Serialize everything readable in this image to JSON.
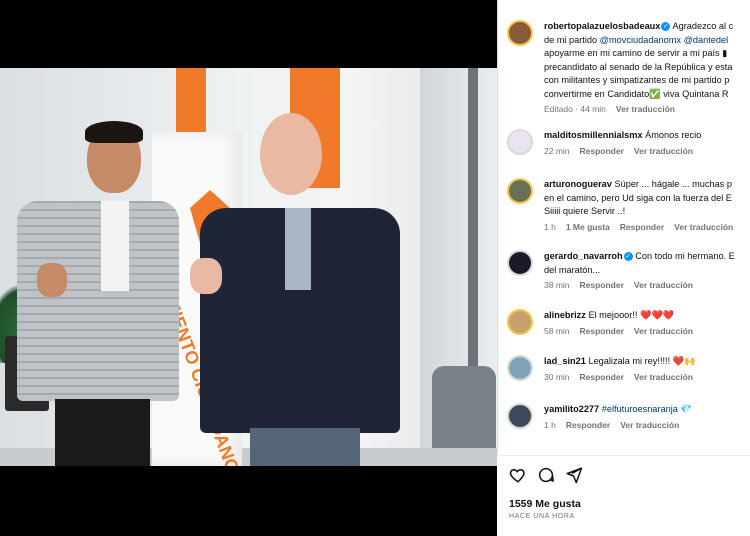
{
  "post_image": {
    "flag_text": "MOVIMIENTO CIUDADANO"
  },
  "comments": [
    {
      "username": "robertopalazuelosbadeaux",
      "verified": true,
      "lines": [
        "Agradezco al c",
        "de mi partido @movciudadanomx @dantedel",
        "apoyarme en mi camino de servir a mi país ▮",
        "precandidato al senado de la República y esta",
        "con militantes y simpatizantes de mi partido p",
        "convertirme en Candidato✅ viva Quintana R"
      ],
      "meta": [
        "Editado · 44 min",
        "Ver traducción"
      ],
      "avatar_color": "#8a5a3a"
    },
    {
      "username": "malditosmillennialsmx",
      "text": "Ámonos recio",
      "meta": [
        "22 min",
        "Responder",
        "Ver traducción"
      ],
      "avatar_color": "#e9e4f0"
    },
    {
      "username": "arturonoguerav",
      "lines": [
        "Súper ... hágale ... muchas p",
        "en el camino, pero Ud siga con la fuerza del E",
        "Siiiii quiere Servir ..!"
      ],
      "meta": [
        "1 h",
        "1 Me gusta",
        "Responder",
        "Ver traducción"
      ],
      "avatar_color": "#6a6f5a"
    },
    {
      "username": "gerardo_navarroh",
      "verified": true,
      "lines": [
        "Con todo mi hermano. E",
        "del maratón..."
      ],
      "meta": [
        "38 min",
        "Responder",
        "Ver traducción"
      ],
      "avatar_color": "#1a1a2a"
    },
    {
      "username": "alinebrizz",
      "text": "El mejooor!! ❤️❤️❤️",
      "meta": [
        "58 min",
        "Responder",
        "Ver traducción"
      ],
      "avatar_color": "#c9a070"
    },
    {
      "username": "lad_sin21",
      "text": "Legalizala mi rey!!!!! ❤️🙌",
      "meta": [
        "30 min",
        "Responder",
        "Ver traducción"
      ],
      "avatar_color": "#7fa6b8"
    },
    {
      "username": "yamilito2277",
      "hashtag": "#elfuturoesnaranja",
      "emoji": "💎",
      "meta": [
        "1 h",
        "Responder",
        "Ver traducción"
      ],
      "avatar_color": "#3a4a5a"
    }
  ],
  "mentions": [
    "@movciudadanomx",
    "@dantedel"
  ],
  "footer": {
    "likes": "1559 Me gusta",
    "time": "HACE UNA HORA"
  },
  "icons": [
    "heart-icon",
    "comment-icon",
    "share-icon"
  ]
}
